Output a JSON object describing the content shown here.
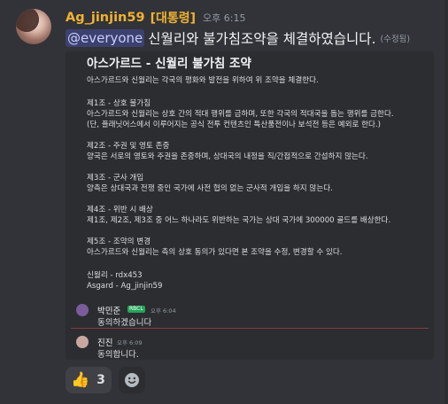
{
  "message": {
    "username": "Ag_jinjin59",
    "role_tag": "[대통령]",
    "timestamp": "오후 6:15",
    "mention": "@everyone",
    "text": "신월리와 불가침조약을 체결하였습니다.",
    "edited": "(수정됨)"
  },
  "embed": {
    "title": "아스가르드 - 신월리  불가침 조약",
    "lines": [
      "아스가르드와 신월리는 각국의 평화와 발전을 위하여 위 조약을 체결한다.",
      "제1조 - 상호 불가침",
      "아스가르드와 신월리는 상호 간의 적대 행위를 금하며, 또한 각국의 적대국을 돕는 행위를 금한다.",
      "(단, 플래닛어스에서 이루어지는 공식 전투 컨텐츠인 특산품전이나 보석전 등은 예외로 한다.)",
      "제2조 - 주권 및 영토 존중",
      "양국은 서로의 영토와 주권을 존중하며, 상대국의 내정을 직/간접적으로 간섭하지 않는다.",
      "제3조 - 군사 개입",
      "양측은 상대국과 전쟁 중인 국가에 사전 협의 없는 군사적 개입을 하지 않는다.",
      "제4조 - 위반 시 배상",
      "제1조, 제2조, 제3조 중 어느 하나라도 위반하는 국가는 상대 국가에 300000 골드를 배상한다.",
      "제5조 - 조약의 변경",
      "아스가르드와 신월리는 측의 상호 동의가 있다면 본 조약을 수정, 변경할 수 있다.",
      "신월리 - rdx453",
      "Asgard - Ag_jinjin59"
    ]
  },
  "replies": [
    {
      "name": "박민준",
      "badge": "RBCL",
      "time": "오후 6:04",
      "text": "동의하겠습니다"
    },
    {
      "name": "진진",
      "badge": "",
      "time": "오후 6:09",
      "text": "동의합니다."
    }
  ],
  "reactions": [
    {
      "emoji": "👍",
      "count": "3"
    }
  ],
  "colors": {
    "background": "#313338",
    "embed_bg": "#2b2d31",
    "username": "#f0b232",
    "mention_bg": "#5865f2"
  }
}
